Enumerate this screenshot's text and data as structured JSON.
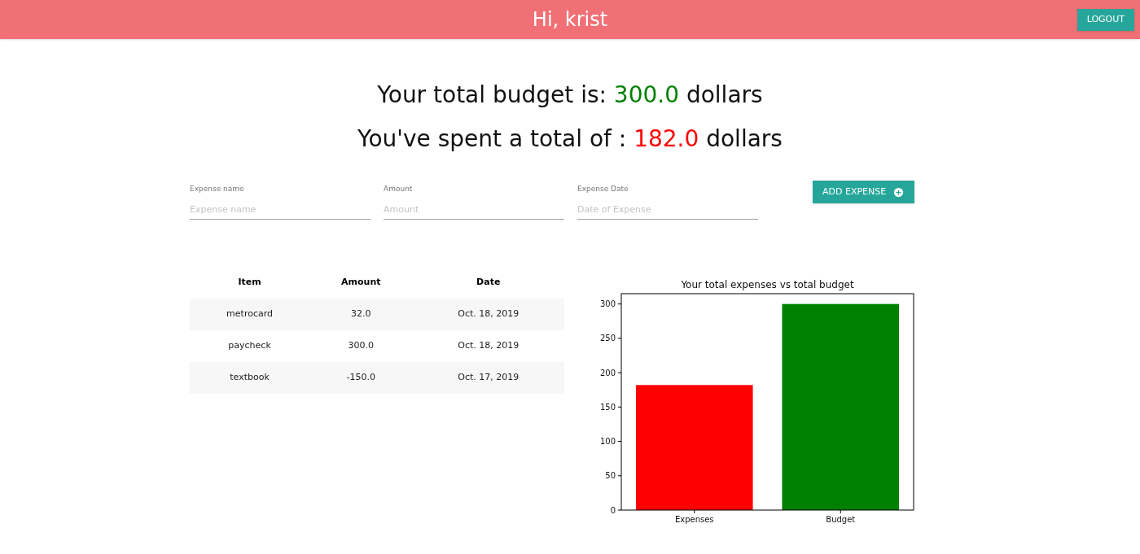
{
  "header": {
    "greeting": "Hi, krist",
    "logout": "LOGOUT"
  },
  "summary": {
    "budget": {
      "prefix": "Your total budget is: ",
      "value": "300.0",
      "suffix": " dollars"
    },
    "spent": {
      "prefix": "You've spent a total of : ",
      "value": "182.0",
      "suffix": " dollars"
    }
  },
  "form": {
    "fields": [
      {
        "label": "Expense name",
        "placeholder": "Expense name"
      },
      {
        "label": "Amount",
        "placeholder": "Amount"
      },
      {
        "label": "Expense Date",
        "placeholder": "Date of Expense"
      }
    ],
    "button": "ADD EXPENSE"
  },
  "table": {
    "columns": [
      "Item",
      "Amount",
      "Date"
    ],
    "rows": [
      [
        "metrocard",
        "32.0",
        "Oct. 18, 2019"
      ],
      [
        "paycheck",
        "300.0",
        "Oct. 18, 2019"
      ],
      [
        "textbook",
        "-150.0",
        "Oct. 17, 2019"
      ]
    ]
  },
  "chart": {
    "chart_data": {
      "type": "bar",
      "title": "Your total expenses vs total budget",
      "categories": [
        "Expenses",
        "Budget"
      ],
      "series": [
        {
          "color": "#ff0000",
          "values": [
            182,
            null
          ]
        },
        {
          "color": "#008000",
          "values": [
            null,
            300
          ]
        }
      ],
      "ylim": [
        0,
        315
      ],
      "yticks": [
        0,
        50,
        100,
        150,
        200,
        250,
        300
      ]
    }
  }
}
